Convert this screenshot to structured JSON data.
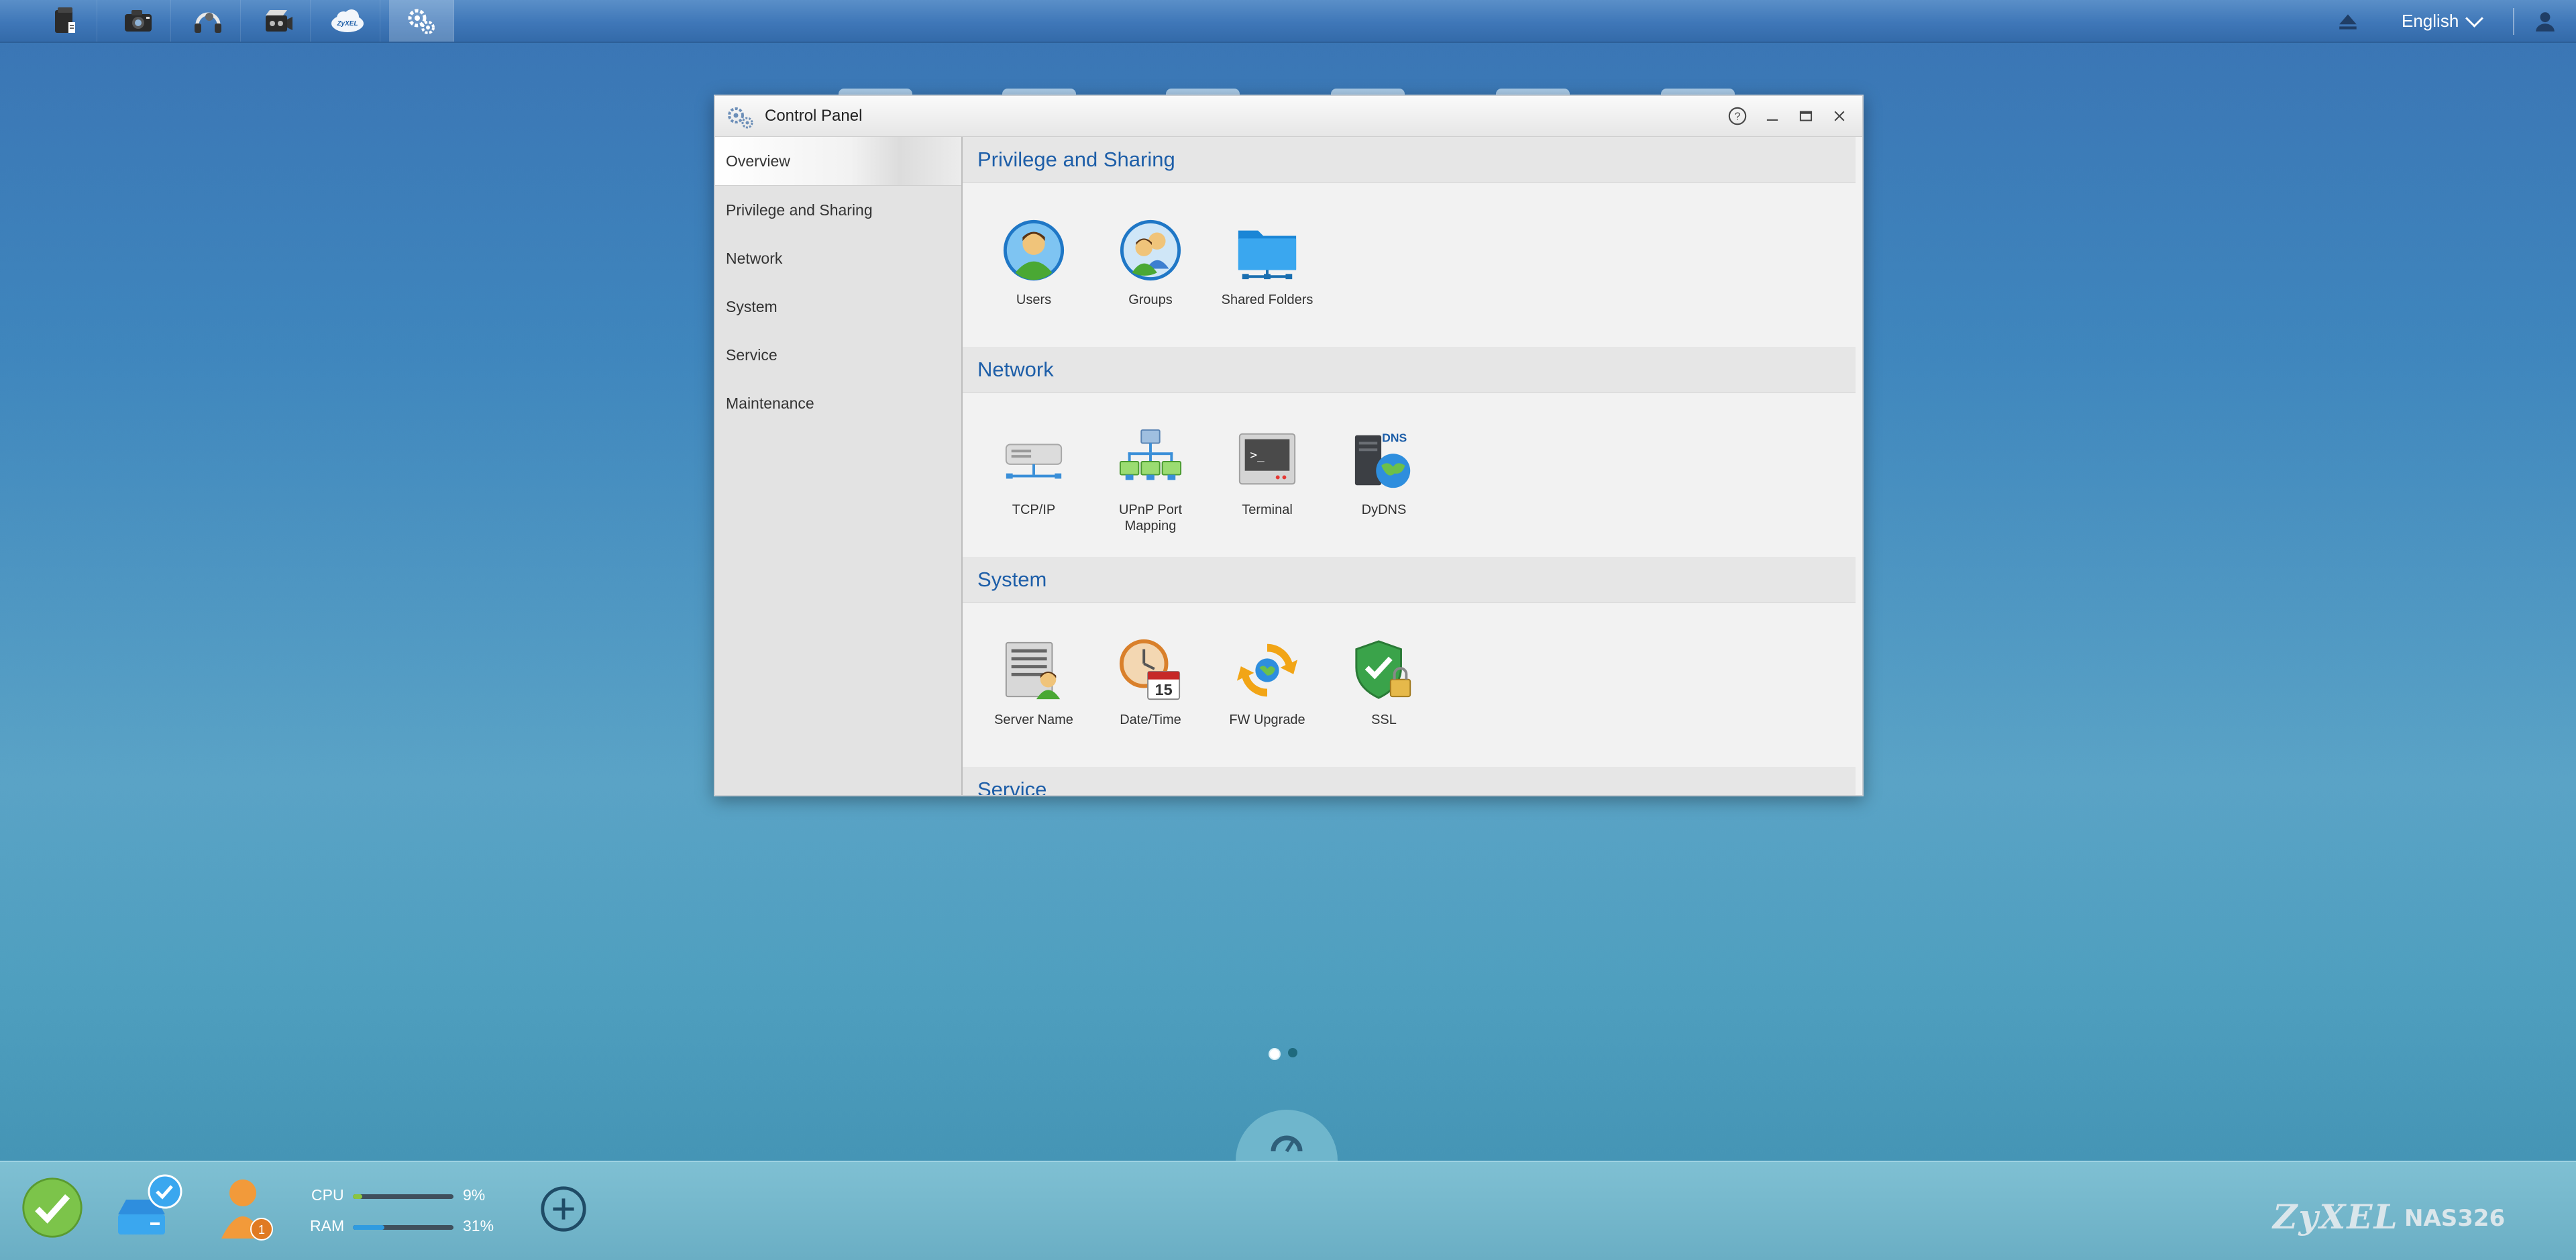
{
  "topbar": {
    "apps": [
      {
        "name": "file-browser-icon"
      },
      {
        "name": "photo-app-icon"
      },
      {
        "name": "music-app-icon"
      },
      {
        "name": "video-app-icon"
      },
      {
        "name": "zyxel-cloud-icon",
        "text": "ZyXEL"
      },
      {
        "name": "control-panel-icon",
        "active": true
      }
    ],
    "language": "English"
  },
  "window": {
    "title": "Control Panel",
    "sidebar": [
      {
        "label": "Overview",
        "active": true
      },
      {
        "label": "Privilege and Sharing"
      },
      {
        "label": "Network"
      },
      {
        "label": "System"
      },
      {
        "label": "Service"
      },
      {
        "label": "Maintenance"
      }
    ],
    "sections": [
      {
        "title": "Privilege and Sharing",
        "items": [
          {
            "label": "Users",
            "icon": "users-icon"
          },
          {
            "label": "Groups",
            "icon": "groups-icon"
          },
          {
            "label": "Shared Folders",
            "icon": "shared-folders-icon"
          }
        ]
      },
      {
        "title": "Network",
        "items": [
          {
            "label": "TCP/IP",
            "icon": "tcpip-icon"
          },
          {
            "label": "UPnP Port Mapping",
            "icon": "upnp-icon"
          },
          {
            "label": "Terminal",
            "icon": "terminal-icon"
          },
          {
            "label": "DyDNS",
            "icon": "dydns-icon",
            "badge": "DNS"
          }
        ]
      },
      {
        "title": "System",
        "items": [
          {
            "label": "Server Name",
            "icon": "server-name-icon"
          },
          {
            "label": "Date/Time",
            "icon": "date-time-icon",
            "badge": "15"
          },
          {
            "label": "FW Upgrade",
            "icon": "fw-upgrade-icon"
          },
          {
            "label": "SSL",
            "icon": "ssl-icon"
          }
        ]
      },
      {
        "title": "Service"
      }
    ]
  },
  "bottombar": {
    "user_badge": "1",
    "cpu": {
      "label": "CPU",
      "value": "9%",
      "fraction": 0.09
    },
    "ram": {
      "label": "RAM",
      "value": "31%",
      "fraction": 0.31
    },
    "brand": "ZyXEL",
    "model": "NAS326"
  },
  "colors": {
    "accent": "#1d5ea8",
    "cpu_fill": "#8bc53f",
    "ram_fill": "#2f9be0"
  }
}
